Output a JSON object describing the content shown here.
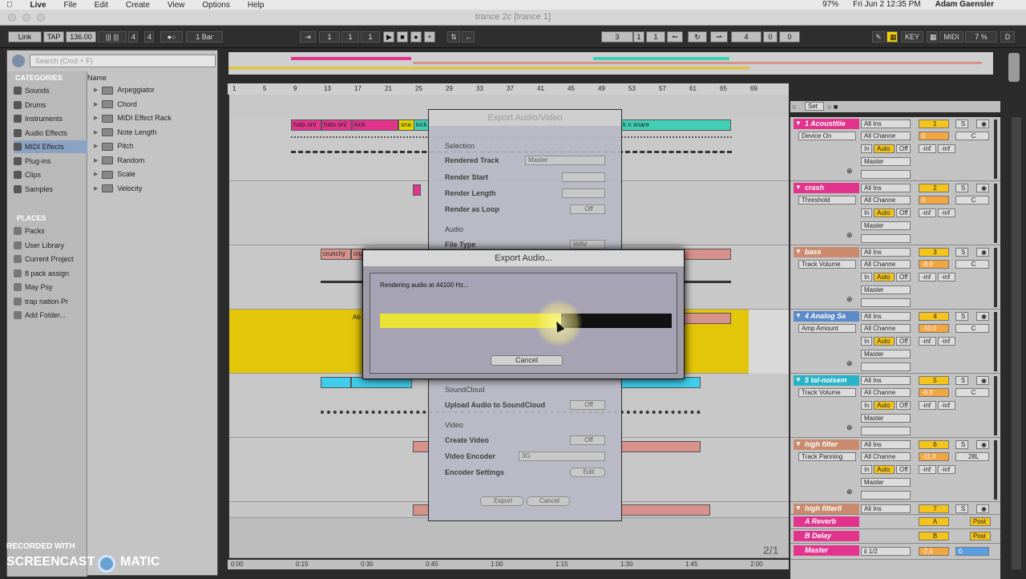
{
  "menubar": {
    "items": [
      "Live",
      "File",
      "Edit",
      "Create",
      "View",
      "Options",
      "Help"
    ],
    "battery": "97%",
    "datetime": "Fri Jun 2 12:35 PM",
    "user": "Adam Gaensler"
  },
  "window": {
    "title": "trance 2c [trance 1]"
  },
  "transport": {
    "link": "Link",
    "tap": "TAP",
    "tempo": "136.00",
    "sig_num": "4",
    "sig_den": "4",
    "quant": "1 Bar",
    "pos": [
      "1",
      "1",
      "1"
    ],
    "loop_start": [
      "3",
      "1",
      "1"
    ],
    "loop_len": [
      "4",
      "0",
      "0"
    ],
    "key": "KEY",
    "midi": "MIDI",
    "cpu": "7 %",
    "d": "D"
  },
  "browser": {
    "search_placeholder": "Search (Cmd + F)",
    "categories_header": "CATEGORIES",
    "name_header": "Name",
    "categories": [
      "Sounds",
      "Drums",
      "Instruments",
      "Audio Effects",
      "MIDI Effects",
      "Plug-ins",
      "Clips",
      "Samples"
    ],
    "selected_category": "MIDI Effects",
    "items": [
      "Arpeggiator",
      "Chord",
      "MIDI Effect Rack",
      "Note Length",
      "Pitch",
      "Random",
      "Scale",
      "Velocity"
    ],
    "places_header": "PLACES",
    "places": [
      "Packs",
      "User Library",
      "Current Project",
      "8 pack assign",
      "May Psy",
      "trap nation Pr",
      "Add Folder..."
    ]
  },
  "ruler": {
    "bars": [
      "1",
      "5",
      "9",
      "13",
      "17",
      "21",
      "25",
      "29",
      "33",
      "37",
      "41",
      "45",
      "49",
      "53",
      "57",
      "61",
      "65",
      "69"
    ],
    "times": [
      "0:00",
      "0:15",
      "0:30",
      "0:45",
      "1:00",
      "1:15",
      "1:30",
      "1:45",
      "2:00"
    ],
    "zoom": "2/1"
  },
  "clips": {
    "hats1": "hats onl",
    "hats2": "hats onl",
    "kick": "kick",
    "snare1": "sna",
    "kick2": "kick",
    "snare2": "k n snare",
    "crunchy": "crunchy",
    "cru": "cru",
    "ab": "Ab"
  },
  "mixer": {
    "set": "Set",
    "tracks": [
      {
        "name": "1 Acoustitie",
        "color": "#e2338d",
        "device": "Device On",
        "input": "All Ins",
        "channel": "All Channe",
        "out": "Master",
        "num": "1",
        "vol": "0",
        "pan": "C",
        "inf1": "-inf",
        "inf2": "-inf"
      },
      {
        "name": "crash",
        "color": "#e2338d",
        "device": "Threshold",
        "input": "All Ins",
        "channel": "All Channe",
        "out": "Master",
        "num": "2",
        "vol": "0",
        "pan": "C",
        "inf1": "-inf",
        "inf2": "-inf"
      },
      {
        "name": "bass",
        "color": "#c98a6e",
        "device": "Track Volume",
        "input": "All Ins",
        "channel": "All Channe",
        "out": "Master",
        "num": "3",
        "vol": "-8.0",
        "pan": "C",
        "inf1": "-inf",
        "inf2": "-inf"
      },
      {
        "name": "4 Analog Sa",
        "color": "#5a8ac7",
        "device": "Amp Amount",
        "input": "All Ins",
        "channel": "All Channe",
        "out": "Master",
        "num": "4",
        "vol": "-10.0",
        "pan": "C",
        "inf1": "-inf",
        "inf2": "-inf"
      },
      {
        "name": "5 tal-noisem",
        "color": "#2ab3c8",
        "device": "Track Volume",
        "input": "All Ins",
        "channel": "All Channe",
        "out": "Master",
        "num": "5",
        "vol": "-6.0",
        "pan": "C",
        "inf1": "-inf",
        "inf2": "-inf"
      },
      {
        "name": "high filter",
        "color": "#c98a6e",
        "device": "Track Panning",
        "input": "All Ins",
        "channel": "All Channe",
        "out": "Master",
        "num": "6",
        "vol": "-11.0",
        "pan": "28L",
        "inf1": "-inf",
        "inf2": "-inf"
      },
      {
        "name": "high filterll",
        "color": "#c98a6e",
        "device": "",
        "input": "All Ins",
        "channel": "",
        "out": "",
        "num": "7",
        "vol": "",
        "pan": "",
        "inf1": "",
        "inf2": ""
      }
    ],
    "in": "In",
    "auto": "Auto",
    "off": "Off",
    "s": "S",
    "returns": [
      {
        "name": "A Reverb",
        "letter": "A",
        "post": "Post",
        "color": "#e2338d"
      },
      {
        "name": "B Delay",
        "letter": "B",
        "post": "Post",
        "color": "#e2338d"
      }
    ],
    "master": {
      "name": "Master",
      "cue": "ii 1/2",
      "vol": "-2.6",
      "val": "0"
    }
  },
  "export_dialog": {
    "title": "Export Audio/Video",
    "selection": "Selection",
    "rendered_track": "Rendered Track",
    "rendered_track_value": "Master",
    "render_start": "Render Start",
    "render_length": "Render Length",
    "render_as_loop": "Render as Loop",
    "render_as_loop_value": "Off",
    "audio": "Audio",
    "file_type": "File Type",
    "file_type_value": "WAV",
    "soundcloud": "SoundCloud",
    "upload": "Upload Audio to SoundCloud",
    "upload_value": "Off",
    "video": "Video",
    "create_video": "Create Video",
    "create_video_value": "Off",
    "video_encoder": "Video Encoder",
    "video_encoder_value": "3G",
    "encoder_settings": "Encoder Settings",
    "edit": "Edit",
    "export": "Export",
    "cancel": "Cancel"
  },
  "progress_dialog": {
    "title": "Export Audio...",
    "message": "Rendering audio at 44100 Hz...",
    "progress": 0.62,
    "cancel": "Cancel"
  },
  "watermark": {
    "line1": "RECORDED WITH",
    "line2": "SCREENCAST",
    "line3": "MATIC"
  }
}
